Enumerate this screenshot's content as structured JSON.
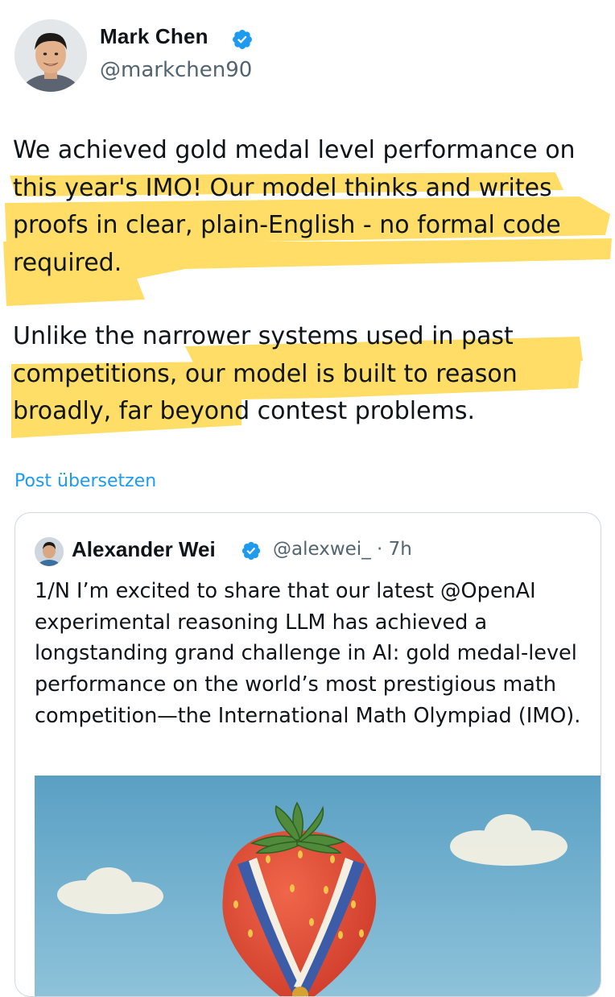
{
  "author": {
    "name": "Mark Chen",
    "handle": "@markchen90",
    "avatar_icon": "profile-photo",
    "verified_icon": "verified-badge-icon"
  },
  "post": {
    "paragraphs": [
      "We achieved gold medal level performance on this year's IMO! Our model thinks and writes proofs in clear, plain-English - no formal code required.",
      "Unlike the narrower systems used in past competitions, our model is built to reason broadly, far beyond contest problems."
    ],
    "highlight_color": "#ffd84d",
    "translate_label": "Post übersetzen"
  },
  "quoted_post": {
    "author_name": "Alexander Wei",
    "meta": "@alexwei_ · 7h",
    "text": "1/N I’m excited to share that our latest @OpenAI experimental reasoning LLM has achieved a longstanding grand challenge in AI: gold medal-level performance on the world’s most prestigious math competition—the International Math Olympiad (IMO).",
    "media_icon": "strawberry-medal-illustration"
  },
  "colors": {
    "accent": "#1d9bf0",
    "secondary_text": "#536471",
    "border": "#cfd9de"
  }
}
